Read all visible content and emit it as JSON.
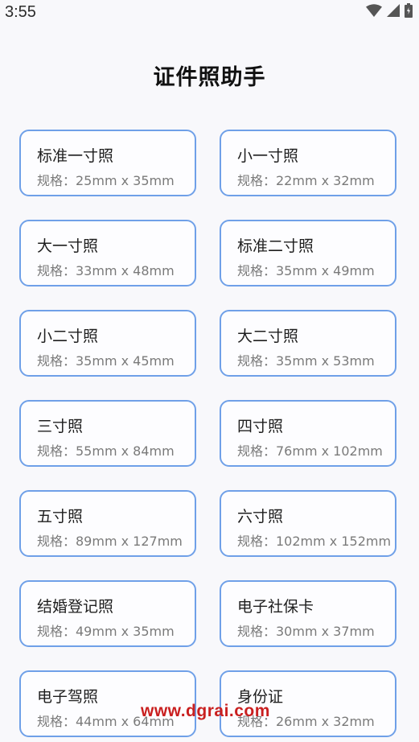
{
  "status_bar": {
    "time": "3:55",
    "icons": [
      "wifi-icon",
      "cell-signal-icon",
      "battery-icon"
    ]
  },
  "title": "证件照助手",
  "cards": [
    {
      "name": "标准一寸照",
      "spec": "规格：25mm x 35mm"
    },
    {
      "name": "小一寸照",
      "spec": "规格：22mm x 32mm"
    },
    {
      "name": "大一寸照",
      "spec": "规格：33mm x 48mm"
    },
    {
      "name": "标准二寸照",
      "spec": "规格：35mm x 49mm"
    },
    {
      "name": "小二寸照",
      "spec": "规格：35mm x 45mm"
    },
    {
      "name": "大二寸照",
      "spec": "规格：35mm x 53mm"
    },
    {
      "name": "三寸照",
      "spec": "规格：55mm x 84mm"
    },
    {
      "name": "四寸照",
      "spec": "规格：76mm x 102mm"
    },
    {
      "name": "五寸照",
      "spec": "规格：89mm x 127mm"
    },
    {
      "name": "六寸照",
      "spec": "规格：102mm x 152mm"
    },
    {
      "name": "结婚登记照",
      "spec": "规格：49mm x 35mm"
    },
    {
      "name": "电子社保卡",
      "spec": "规格：30mm x 37mm"
    },
    {
      "name": "电子驾照",
      "spec": "规格：44mm x 64mm"
    },
    {
      "name": "身份证",
      "spec": "规格：26mm x 32mm"
    }
  ],
  "watermark": "www.dgrai.com",
  "colors": {
    "card_border": "#6fa0e8",
    "background": "#f8f8fb",
    "watermark": "#c91f1f"
  }
}
